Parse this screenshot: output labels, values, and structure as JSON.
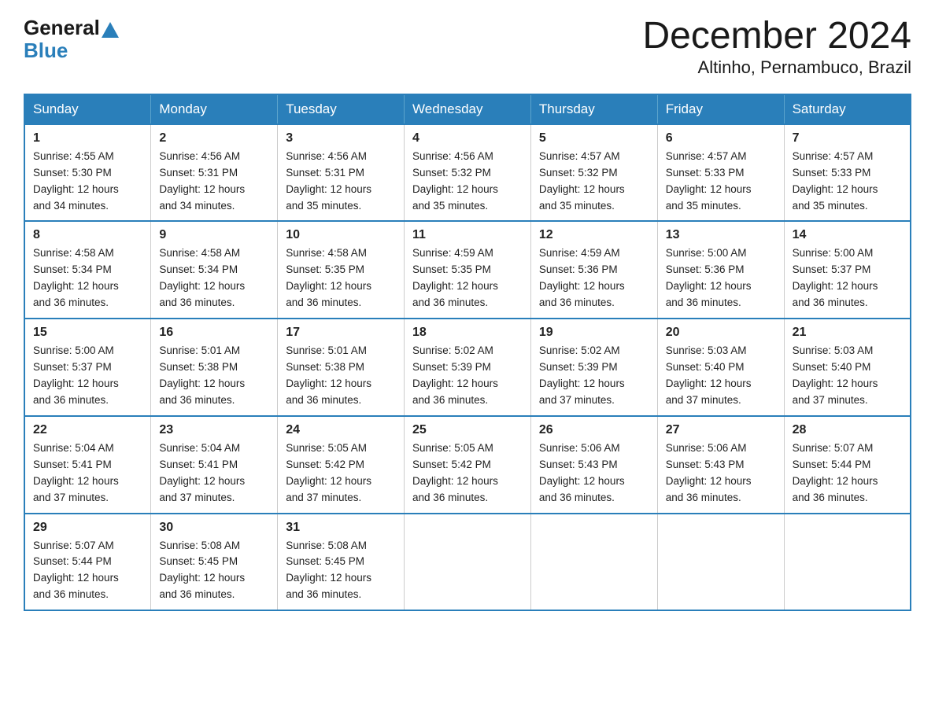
{
  "logo": {
    "general": "General",
    "blue": "Blue",
    "arrow": "▲"
  },
  "title": "December 2024",
  "subtitle": "Altinho, Pernambuco, Brazil",
  "weekdays": [
    "Sunday",
    "Monday",
    "Tuesday",
    "Wednesday",
    "Thursday",
    "Friday",
    "Saturday"
  ],
  "weeks": [
    [
      {
        "day": "1",
        "info": "Sunrise: 4:55 AM\nSunset: 5:30 PM\nDaylight: 12 hours\nand 34 minutes."
      },
      {
        "day": "2",
        "info": "Sunrise: 4:56 AM\nSunset: 5:31 PM\nDaylight: 12 hours\nand 34 minutes."
      },
      {
        "day": "3",
        "info": "Sunrise: 4:56 AM\nSunset: 5:31 PM\nDaylight: 12 hours\nand 35 minutes."
      },
      {
        "day": "4",
        "info": "Sunrise: 4:56 AM\nSunset: 5:32 PM\nDaylight: 12 hours\nand 35 minutes."
      },
      {
        "day": "5",
        "info": "Sunrise: 4:57 AM\nSunset: 5:32 PM\nDaylight: 12 hours\nand 35 minutes."
      },
      {
        "day": "6",
        "info": "Sunrise: 4:57 AM\nSunset: 5:33 PM\nDaylight: 12 hours\nand 35 minutes."
      },
      {
        "day": "7",
        "info": "Sunrise: 4:57 AM\nSunset: 5:33 PM\nDaylight: 12 hours\nand 35 minutes."
      }
    ],
    [
      {
        "day": "8",
        "info": "Sunrise: 4:58 AM\nSunset: 5:34 PM\nDaylight: 12 hours\nand 36 minutes."
      },
      {
        "day": "9",
        "info": "Sunrise: 4:58 AM\nSunset: 5:34 PM\nDaylight: 12 hours\nand 36 minutes."
      },
      {
        "day": "10",
        "info": "Sunrise: 4:58 AM\nSunset: 5:35 PM\nDaylight: 12 hours\nand 36 minutes."
      },
      {
        "day": "11",
        "info": "Sunrise: 4:59 AM\nSunset: 5:35 PM\nDaylight: 12 hours\nand 36 minutes."
      },
      {
        "day": "12",
        "info": "Sunrise: 4:59 AM\nSunset: 5:36 PM\nDaylight: 12 hours\nand 36 minutes."
      },
      {
        "day": "13",
        "info": "Sunrise: 5:00 AM\nSunset: 5:36 PM\nDaylight: 12 hours\nand 36 minutes."
      },
      {
        "day": "14",
        "info": "Sunrise: 5:00 AM\nSunset: 5:37 PM\nDaylight: 12 hours\nand 36 minutes."
      }
    ],
    [
      {
        "day": "15",
        "info": "Sunrise: 5:00 AM\nSunset: 5:37 PM\nDaylight: 12 hours\nand 36 minutes."
      },
      {
        "day": "16",
        "info": "Sunrise: 5:01 AM\nSunset: 5:38 PM\nDaylight: 12 hours\nand 36 minutes."
      },
      {
        "day": "17",
        "info": "Sunrise: 5:01 AM\nSunset: 5:38 PM\nDaylight: 12 hours\nand 36 minutes."
      },
      {
        "day": "18",
        "info": "Sunrise: 5:02 AM\nSunset: 5:39 PM\nDaylight: 12 hours\nand 36 minutes."
      },
      {
        "day": "19",
        "info": "Sunrise: 5:02 AM\nSunset: 5:39 PM\nDaylight: 12 hours\nand 37 minutes."
      },
      {
        "day": "20",
        "info": "Sunrise: 5:03 AM\nSunset: 5:40 PM\nDaylight: 12 hours\nand 37 minutes."
      },
      {
        "day": "21",
        "info": "Sunrise: 5:03 AM\nSunset: 5:40 PM\nDaylight: 12 hours\nand 37 minutes."
      }
    ],
    [
      {
        "day": "22",
        "info": "Sunrise: 5:04 AM\nSunset: 5:41 PM\nDaylight: 12 hours\nand 37 minutes."
      },
      {
        "day": "23",
        "info": "Sunrise: 5:04 AM\nSunset: 5:41 PM\nDaylight: 12 hours\nand 37 minutes."
      },
      {
        "day": "24",
        "info": "Sunrise: 5:05 AM\nSunset: 5:42 PM\nDaylight: 12 hours\nand 37 minutes."
      },
      {
        "day": "25",
        "info": "Sunrise: 5:05 AM\nSunset: 5:42 PM\nDaylight: 12 hours\nand 36 minutes."
      },
      {
        "day": "26",
        "info": "Sunrise: 5:06 AM\nSunset: 5:43 PM\nDaylight: 12 hours\nand 36 minutes."
      },
      {
        "day": "27",
        "info": "Sunrise: 5:06 AM\nSunset: 5:43 PM\nDaylight: 12 hours\nand 36 minutes."
      },
      {
        "day": "28",
        "info": "Sunrise: 5:07 AM\nSunset: 5:44 PM\nDaylight: 12 hours\nand 36 minutes."
      }
    ],
    [
      {
        "day": "29",
        "info": "Sunrise: 5:07 AM\nSunset: 5:44 PM\nDaylight: 12 hours\nand 36 minutes."
      },
      {
        "day": "30",
        "info": "Sunrise: 5:08 AM\nSunset: 5:45 PM\nDaylight: 12 hours\nand 36 minutes."
      },
      {
        "day": "31",
        "info": "Sunrise: 5:08 AM\nSunset: 5:45 PM\nDaylight: 12 hours\nand 36 minutes."
      },
      {
        "day": "",
        "info": ""
      },
      {
        "day": "",
        "info": ""
      },
      {
        "day": "",
        "info": ""
      },
      {
        "day": "",
        "info": ""
      }
    ]
  ]
}
